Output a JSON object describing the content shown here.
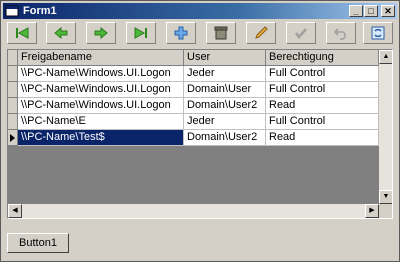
{
  "window": {
    "title": "Form1"
  },
  "toolbar": {
    "buttons": [
      {
        "name": "first-record-button",
        "icon": "first-record-icon",
        "enabled": true
      },
      {
        "name": "previous-record-button",
        "icon": "previous-record-icon",
        "enabled": true
      },
      {
        "name": "next-record-button",
        "icon": "next-record-icon",
        "enabled": true
      },
      {
        "name": "last-record-button",
        "icon": "last-record-icon",
        "enabled": true
      },
      {
        "name": "add-record-button",
        "icon": "add-icon",
        "enabled": true
      },
      {
        "name": "delete-record-button",
        "icon": "trash-icon",
        "enabled": true
      },
      {
        "name": "edit-record-button",
        "icon": "pencil-icon",
        "enabled": true
      },
      {
        "name": "save-record-button",
        "icon": "checkmark-icon",
        "enabled": false
      },
      {
        "name": "undo-button",
        "icon": "undo-icon",
        "enabled": false
      },
      {
        "name": "refresh-button",
        "icon": "refresh-icon",
        "enabled": true
      }
    ]
  },
  "grid": {
    "columns": [
      "Freigabename",
      "User",
      "Berechtigung"
    ],
    "rows": [
      [
        "\\\\PC-Name\\Windows.UI.Logon",
        "Jeder",
        "Full Control"
      ],
      [
        "\\\\PC-Name\\Windows.UI.Logon",
        "Domain\\User",
        "Full Control"
      ],
      [
        "\\\\PC-Name\\Windows.UI.Logon",
        "Domain\\User2",
        "Read"
      ],
      [
        "\\\\PC-Name\\E",
        "Jeder",
        "Full Control"
      ],
      [
        "\\\\PC-Name\\Test$",
        "Domain\\User2",
        "Read"
      ]
    ],
    "selected_row": 4
  },
  "button1": {
    "label": "Button1"
  },
  "colors": {
    "accent": "#0a246a",
    "window": "#d4d0c8"
  }
}
